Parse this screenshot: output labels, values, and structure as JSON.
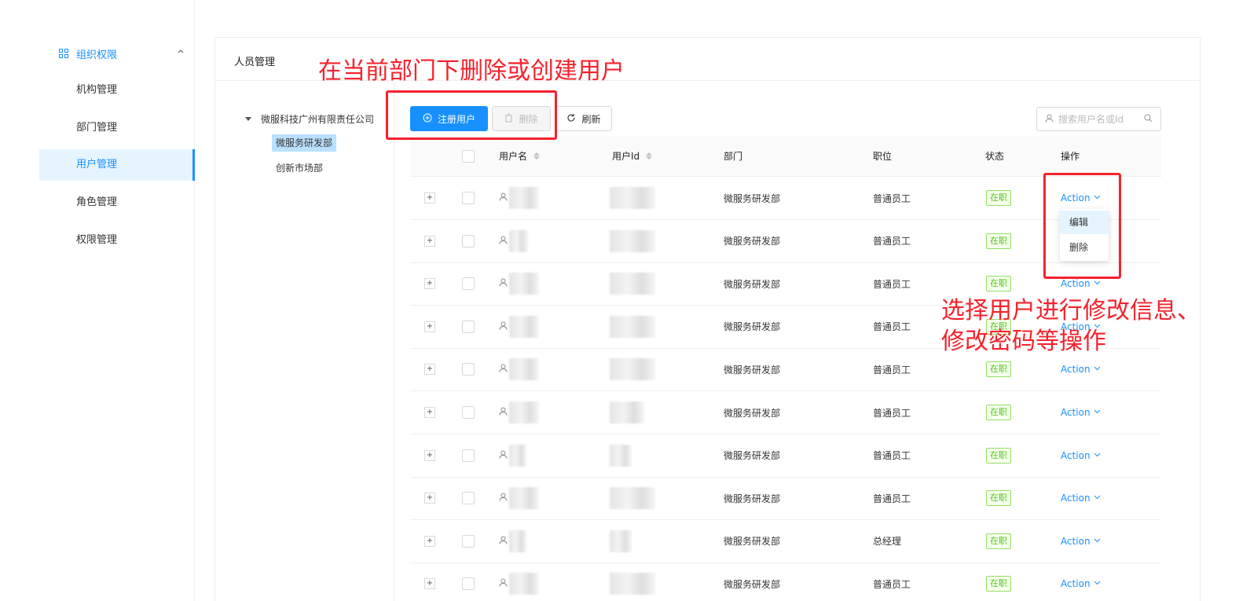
{
  "sidebar": {
    "group_label": "组织权限",
    "items": [
      {
        "label": "机构管理"
      },
      {
        "label": "部门管理"
      },
      {
        "label": "用户管理"
      },
      {
        "label": "角色管理"
      },
      {
        "label": "权限管理"
      }
    ],
    "active_item": "用户管理"
  },
  "card": {
    "title": "人员管理"
  },
  "tree": {
    "root": "微服科技广州有限责任公司",
    "children": [
      {
        "label": "微服务研发部",
        "selected": true
      },
      {
        "label": "创新市场部",
        "selected": false
      }
    ]
  },
  "toolbar": {
    "register_label": "注册用户",
    "delete_label": "删除",
    "refresh_label": "刷新",
    "search_placeholder": "搜索用户名或Id"
  },
  "table": {
    "columns": {
      "username": "用户名",
      "userid": "用户Id",
      "department": "部门",
      "position": "职位",
      "status": "状态",
      "operation": "操作"
    },
    "rows": [
      {
        "department": "微服务研发部",
        "position": "普通员工",
        "status": "在职",
        "action": "Action"
      },
      {
        "department": "微服务研发部",
        "position": "普通员工",
        "status": "在职",
        "action": "Action"
      },
      {
        "department": "微服务研发部",
        "position": "普通员工",
        "status": "在职",
        "action": "Action"
      },
      {
        "department": "微服务研发部",
        "position": "普通员工",
        "status": "在职",
        "action": "Action"
      },
      {
        "department": "微服务研发部",
        "position": "普通员工",
        "status": "在职",
        "action": "Action"
      },
      {
        "department": "微服务研发部",
        "position": "普通员工",
        "status": "在职",
        "action": "Action"
      },
      {
        "department": "微服务研发部",
        "position": "普通员工",
        "status": "在职",
        "action": "Action"
      },
      {
        "department": "微服务研发部",
        "position": "普通员工",
        "status": "在职",
        "action": "Action"
      },
      {
        "department": "微服务研发部",
        "position": "总经理",
        "status": "在职",
        "action": "Action"
      },
      {
        "department": "微服务研发部",
        "position": "普通员工",
        "status": "在职",
        "action": "Action"
      }
    ]
  },
  "dropdown": {
    "items": [
      "编辑",
      "删除"
    ]
  },
  "annotations": {
    "toolbar_note": "在当前部门下删除或创建用户",
    "action_note_line1": "选择用户进行修改信息、",
    "action_note_line2": "修改密码等操作"
  },
  "colors": {
    "primary": "#1890ff",
    "annotation": "#f5222d",
    "status_green": "#52c41a"
  }
}
